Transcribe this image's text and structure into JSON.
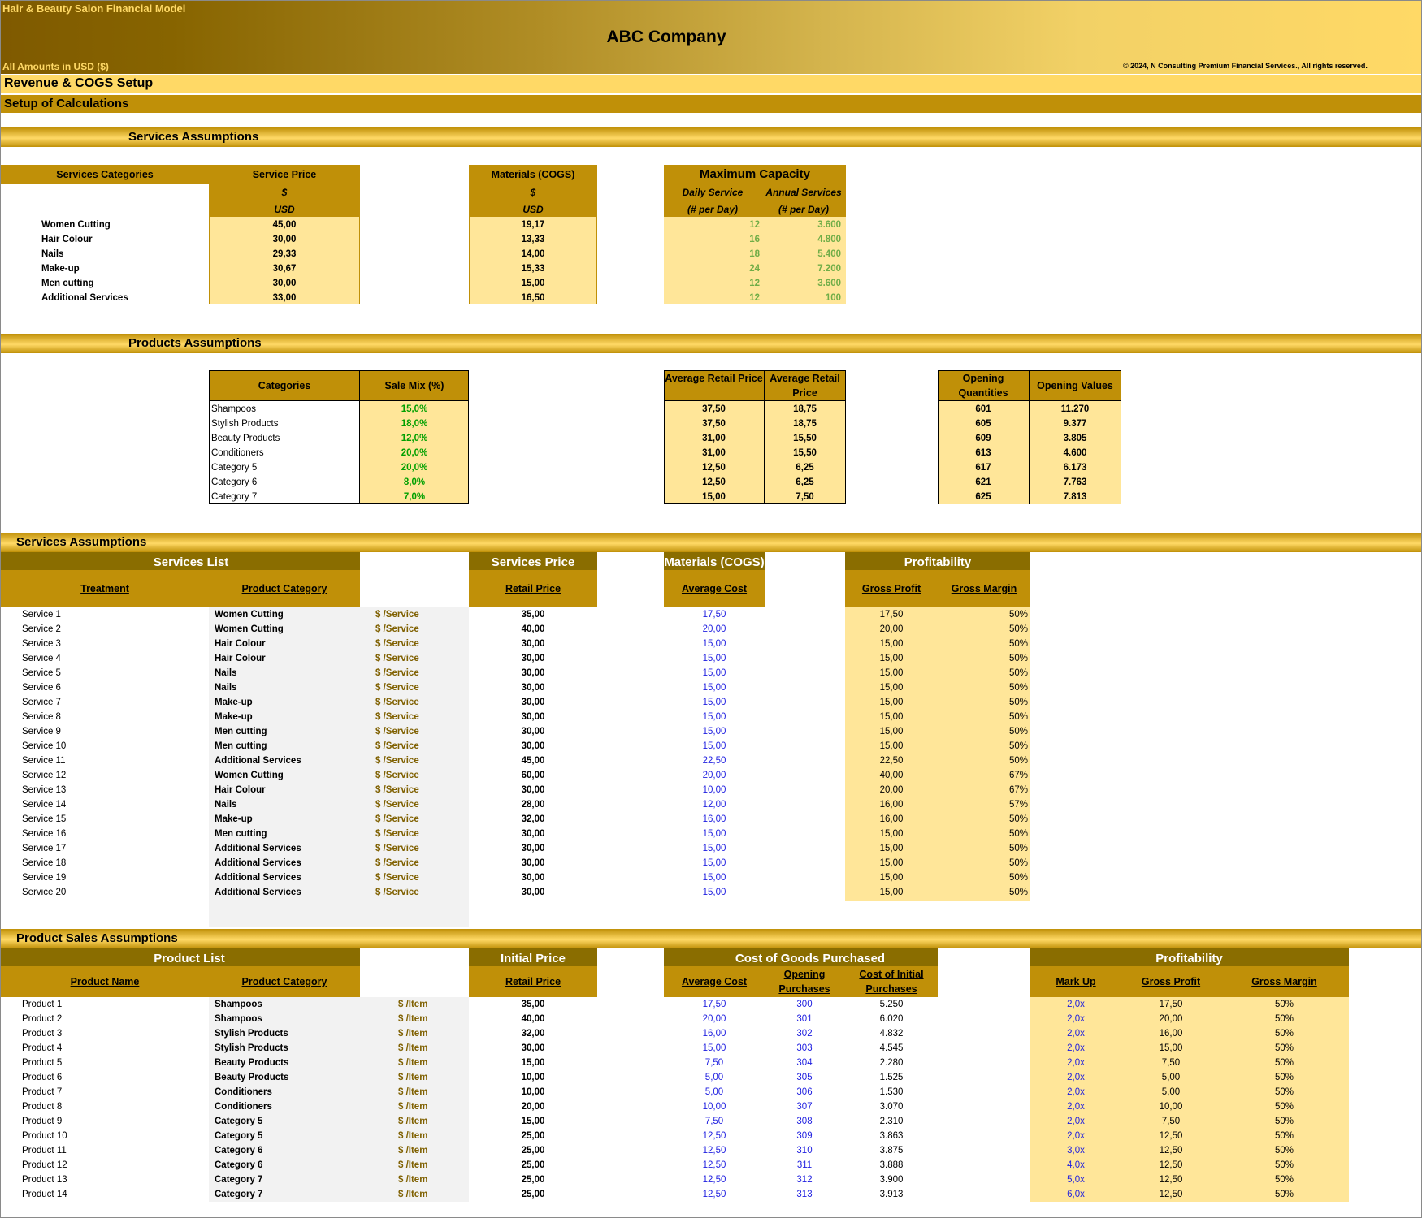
{
  "header": {
    "model_title": "Hair & Beauty Salon Financial Model",
    "company": "ABC Company",
    "currency": "All Amounts in  USD ($)",
    "copyright": "© 2024, N Consulting Premium Financial Services., All rights reserved."
  },
  "page_title": "Revenue & COGS Setup",
  "subtitle": "Setup of Calculations",
  "services_assumptions": {
    "title": "Services Assumptions",
    "col_category": "Services Categories",
    "col_price": "Service Price",
    "col_materials": "Materials (COGS)",
    "dollar": "$",
    "usd": "USD",
    "capacity_title": "Maximum Capacity",
    "col_daily": "Daily Service",
    "col_annual": "Annual Services",
    "per_day": "(# per Day)",
    "rows": [
      {
        "name": "Women Cutting",
        "price": "45,00",
        "materials": "19,17",
        "daily": "12",
        "annual": "3.600"
      },
      {
        "name": "Hair Colour",
        "price": "30,00",
        "materials": "13,33",
        "daily": "16",
        "annual": "4.800"
      },
      {
        "name": "Nails",
        "price": "29,33",
        "materials": "14,00",
        "daily": "18",
        "annual": "5.400"
      },
      {
        "name": "Make-up",
        "price": "30,67",
        "materials": "15,33",
        "daily": "24",
        "annual": "7.200"
      },
      {
        "name": "Men cutting",
        "price": "30,00",
        "materials": "15,00",
        "daily": "12",
        "annual": "3.600"
      },
      {
        "name": "Additional Services",
        "price": "33,00",
        "materials": "16,50",
        "daily": "12",
        "annual": "100"
      }
    ]
  },
  "products_assumptions": {
    "title": "Products Assumptions",
    "col_categories": "Categories",
    "col_mix": "Sale Mix (%)",
    "col_avg1": "Average Retail Price",
    "col_avg2": "Average Retail Price",
    "col_open_qty": "Opening Quantities",
    "col_open_val": "Opening Values",
    "rows": [
      {
        "name": "Shampoos",
        "mix": "15,0%",
        "avg1": "37,50",
        "avg2": "18,75",
        "qty": "601",
        "val": "11.270"
      },
      {
        "name": "Stylish Products",
        "mix": "18,0%",
        "avg1": "37,50",
        "avg2": "18,75",
        "qty": "605",
        "val": "9.377"
      },
      {
        "name": "Beauty Products",
        "mix": "12,0%",
        "avg1": "31,00",
        "avg2": "15,50",
        "qty": "609",
        "val": "3.805"
      },
      {
        "name": "Conditioners",
        "mix": "20,0%",
        "avg1": "31,00",
        "avg2": "15,50",
        "qty": "613",
        "val": "4.600"
      },
      {
        "name": "Category 5",
        "mix": "20,0%",
        "avg1": "12,50",
        "avg2": "6,25",
        "qty": "617",
        "val": "6.173"
      },
      {
        "name": "Category 6",
        "mix": "8,0%",
        "avg1": "12,50",
        "avg2": "6,25",
        "qty": "621",
        "val": "7.763"
      },
      {
        "name": "Category 7",
        "mix": "7,0%",
        "avg1": "15,00",
        "avg2": "7,50",
        "qty": "625",
        "val": "7.813"
      }
    ]
  },
  "services_list": {
    "title": "Services Assumptions",
    "group_list": "Services List",
    "group_price": "Services Price",
    "group_materials": "Materials (COGS)",
    "group_profit": "Profitability",
    "col_treatment": "Treatment",
    "col_category": "Product Category",
    "col_retail": "Retail Price",
    "col_avg_cost": "Average Cost",
    "col_gp": "Gross Profit",
    "col_gm": "Gross Margin",
    "unit": "$ /Service",
    "rows": [
      {
        "name": "Service 1",
        "category": "Women Cutting",
        "price": "35,00",
        "cost": "17,50",
        "gp": "17,50",
        "gm": "50%"
      },
      {
        "name": "Service 2",
        "category": "Women Cutting",
        "price": "40,00",
        "cost": "20,00",
        "gp": "20,00",
        "gm": "50%"
      },
      {
        "name": "Service 3",
        "category": "Hair Colour",
        "price": "30,00",
        "cost": "15,00",
        "gp": "15,00",
        "gm": "50%"
      },
      {
        "name": "Service 4",
        "category": "Hair Colour",
        "price": "30,00",
        "cost": "15,00",
        "gp": "15,00",
        "gm": "50%"
      },
      {
        "name": "Service 5",
        "category": "Nails",
        "price": "30,00",
        "cost": "15,00",
        "gp": "15,00",
        "gm": "50%"
      },
      {
        "name": "Service 6",
        "category": "Nails",
        "price": "30,00",
        "cost": "15,00",
        "gp": "15,00",
        "gm": "50%"
      },
      {
        "name": "Service 7",
        "category": "Make-up",
        "price": "30,00",
        "cost": "15,00",
        "gp": "15,00",
        "gm": "50%"
      },
      {
        "name": "Service 8",
        "category": "Make-up",
        "price": "30,00",
        "cost": "15,00",
        "gp": "15,00",
        "gm": "50%"
      },
      {
        "name": "Service 9",
        "category": "Men cutting",
        "price": "30,00",
        "cost": "15,00",
        "gp": "15,00",
        "gm": "50%"
      },
      {
        "name": "Service 10",
        "category": "Men cutting",
        "price": "30,00",
        "cost": "15,00",
        "gp": "15,00",
        "gm": "50%"
      },
      {
        "name": "Service 11",
        "category": "Additional Services",
        "price": "45,00",
        "cost": "22,50",
        "gp": "22,50",
        "gm": "50%"
      },
      {
        "name": "Service 12",
        "category": "Women Cutting",
        "price": "60,00",
        "cost": "20,00",
        "gp": "40,00",
        "gm": "67%"
      },
      {
        "name": "Service 13",
        "category": "Hair Colour",
        "price": "30,00",
        "cost": "10,00",
        "gp": "20,00",
        "gm": "67%"
      },
      {
        "name": "Service 14",
        "category": "Nails",
        "price": "28,00",
        "cost": "12,00",
        "gp": "16,00",
        "gm": "57%"
      },
      {
        "name": "Service 15",
        "category": "Make-up",
        "price": "32,00",
        "cost": "16,00",
        "gp": "16,00",
        "gm": "50%"
      },
      {
        "name": "Service 16",
        "category": "Men cutting",
        "price": "30,00",
        "cost": "15,00",
        "gp": "15,00",
        "gm": "50%"
      },
      {
        "name": "Service 17",
        "category": "Additional Services",
        "price": "30,00",
        "cost": "15,00",
        "gp": "15,00",
        "gm": "50%"
      },
      {
        "name": "Service 18",
        "category": "Additional Services",
        "price": "30,00",
        "cost": "15,00",
        "gp": "15,00",
        "gm": "50%"
      },
      {
        "name": "Service 19",
        "category": "Additional Services",
        "price": "30,00",
        "cost": "15,00",
        "gp": "15,00",
        "gm": "50%"
      },
      {
        "name": "Service 20",
        "category": "Additional Services",
        "price": "30,00",
        "cost": "15,00",
        "gp": "15,00",
        "gm": "50%"
      }
    ]
  },
  "product_sales": {
    "title": "Product Sales Assumptions",
    "group_list": "Product List",
    "group_price": "Initial Price",
    "group_cogs": "Cost of Goods Purchased",
    "group_profit": "Profitability",
    "col_name": "Product Name",
    "col_category": "Product Category",
    "col_retail": "Retail Price",
    "col_avg_cost": "Average Cost",
    "col_open_purch": "Opening Purchases",
    "col_init_purch": "Cost of Initial Purchases",
    "col_markup": "Mark Up",
    "col_gp": "Gross Profit",
    "col_gm": "Gross Margin",
    "unit": "$ /Item",
    "rows": [
      {
        "name": "Product 1",
        "category": "Shampoos",
        "price": "35,00",
        "cost": "17,50",
        "open": "300",
        "init": "5.250",
        "markup": "2,0x",
        "gp": "17,50",
        "gm": "50%"
      },
      {
        "name": "Product 2",
        "category": "Shampoos",
        "price": "40,00",
        "cost": "20,00",
        "open": "301",
        "init": "6.020",
        "markup": "2,0x",
        "gp": "20,00",
        "gm": "50%"
      },
      {
        "name": "Product 3",
        "category": "Stylish Products",
        "price": "32,00",
        "cost": "16,00",
        "open": "302",
        "init": "4.832",
        "markup": "2,0x",
        "gp": "16,00",
        "gm": "50%"
      },
      {
        "name": "Product 4",
        "category": "Stylish Products",
        "price": "30,00",
        "cost": "15,00",
        "open": "303",
        "init": "4.545",
        "markup": "2,0x",
        "gp": "15,00",
        "gm": "50%"
      },
      {
        "name": "Product 5",
        "category": "Beauty Products",
        "price": "15,00",
        "cost": "7,50",
        "open": "304",
        "init": "2.280",
        "markup": "2,0x",
        "gp": "7,50",
        "gm": "50%"
      },
      {
        "name": "Product 6",
        "category": "Beauty Products",
        "price": "10,00",
        "cost": "5,00",
        "open": "305",
        "init": "1.525",
        "markup": "2,0x",
        "gp": "5,00",
        "gm": "50%"
      },
      {
        "name": "Product 7",
        "category": "Conditioners",
        "price": "10,00",
        "cost": "5,00",
        "open": "306",
        "init": "1.530",
        "markup": "2,0x",
        "gp": "5,00",
        "gm": "50%"
      },
      {
        "name": "Product 8",
        "category": "Conditioners",
        "price": "20,00",
        "cost": "10,00",
        "open": "307",
        "init": "3.070",
        "markup": "2,0x",
        "gp": "10,00",
        "gm": "50%"
      },
      {
        "name": "Product 9",
        "category": "Category 5",
        "price": "15,00",
        "cost": "7,50",
        "open": "308",
        "init": "2.310",
        "markup": "2,0x",
        "gp": "7,50",
        "gm": "50%"
      },
      {
        "name": "Product 10",
        "category": "Category 5",
        "price": "25,00",
        "cost": "12,50",
        "open": "309",
        "init": "3.863",
        "markup": "2,0x",
        "gp": "12,50",
        "gm": "50%"
      },
      {
        "name": "Product 11",
        "category": "Category 6",
        "price": "25,00",
        "cost": "12,50",
        "open": "310",
        "init": "3.875",
        "markup": "3,0x",
        "gp": "12,50",
        "gm": "50%"
      },
      {
        "name": "Product 12",
        "category": "Category 6",
        "price": "25,00",
        "cost": "12,50",
        "open": "311",
        "init": "3.888",
        "markup": "4,0x",
        "gp": "12,50",
        "gm": "50%"
      },
      {
        "name": "Product 13",
        "category": "Category 7",
        "price": "25,00",
        "cost": "12,50",
        "open": "312",
        "init": "3.900",
        "markup": "5,0x",
        "gp": "12,50",
        "gm": "50%"
      },
      {
        "name": "Product 14",
        "category": "Category 7",
        "price": "25,00",
        "cost": "12,50",
        "open": "313",
        "init": "3.913",
        "markup": "6,0x",
        "gp": "12,50",
        "gm": "50%"
      }
    ]
  }
}
